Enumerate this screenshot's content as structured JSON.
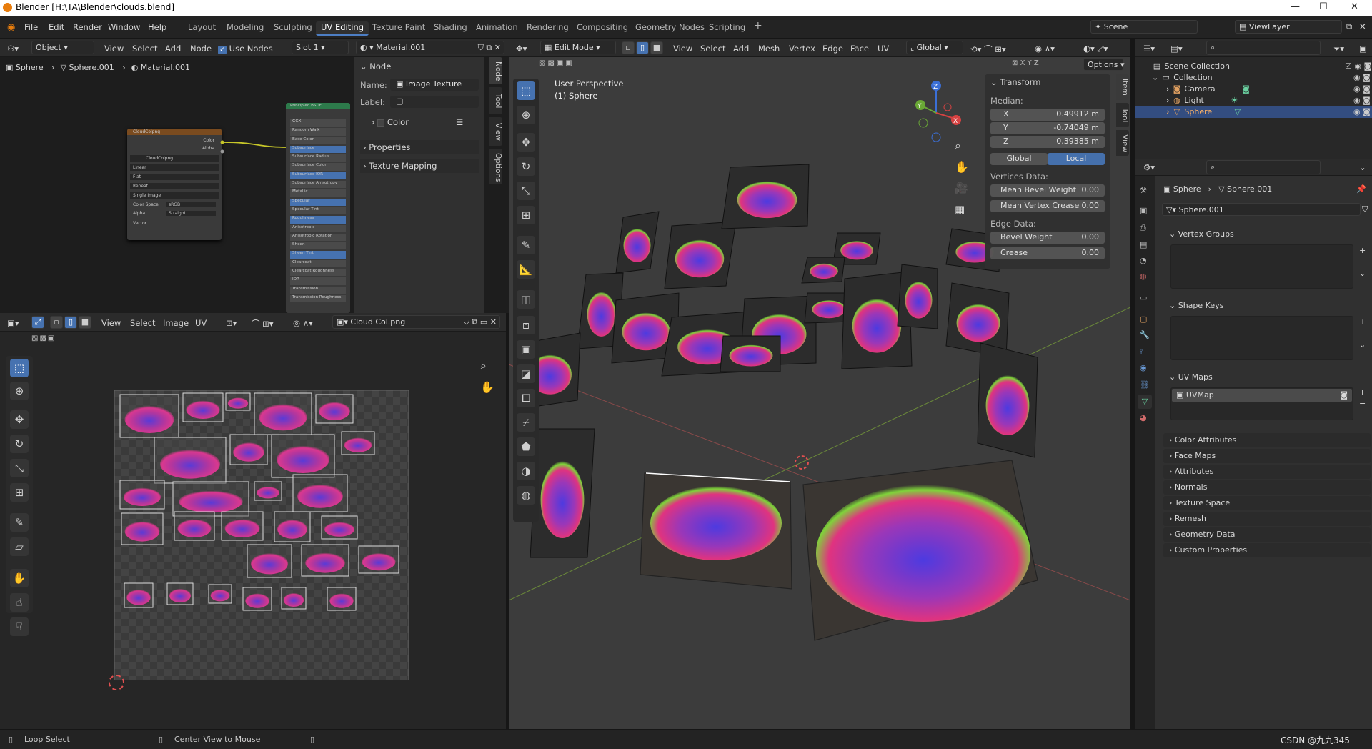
{
  "window": {
    "title": "Blender [H:\\TA\\Blender\\clouds.blend]",
    "min": "—",
    "max": "☐",
    "close": "✕"
  },
  "menu": [
    "File",
    "Edit",
    "Render",
    "Window",
    "Help"
  ],
  "workspaces": [
    "Layout",
    "Modeling",
    "Sculpting",
    "UV Editing",
    "Texture Paint",
    "Shading",
    "Animation",
    "Rendering",
    "Compositing",
    "Geometry Nodes",
    "Scripting"
  ],
  "active_workspace": "UV Editing",
  "add_workspace": "+",
  "scene": {
    "name": "Scene",
    "view_layer": "ViewLayer"
  },
  "node_editor": {
    "mode": "Object",
    "menus": [
      "View",
      "Select",
      "Add",
      "Node"
    ],
    "use_nodes": "Use Nodes",
    "slot": "Slot 1",
    "material": "Material.001",
    "breadcrumb": [
      "Sphere",
      "Sphere.001",
      "Material.001"
    ],
    "image_node": {
      "title": "CloudColpng",
      "outputs": [
        "Color",
        "Alpha"
      ],
      "image": "CloudColpng",
      "interp": "Linear",
      "proj": "Flat",
      "ext": "Repeat",
      "source": "Single Image",
      "colorspace_label": "Color Space",
      "colorspace": "sRGB",
      "alpha_label": "Alpha",
      "alpha": "Straight",
      "vector": "Vector"
    },
    "bsdf_node": {
      "title": "Principled BSDF",
      "rows": [
        "GGX",
        "Random Walk",
        "Base Color",
        "Subsurface",
        "Subsurface Radius",
        "Subsurface Color",
        "Subsurface IOR",
        "Subsurface Anisotropy",
        "Metallic",
        "Specular",
        "Specular Tint",
        "Roughness",
        "Anisotropic",
        "Anisotropic Rotation",
        "Sheen",
        "Sheen Tint",
        "Clearcoat",
        "Clearcoat Roughness",
        "IOR",
        "Transmission",
        "Transmission Roughness"
      ]
    },
    "sidebar": {
      "section": "Node",
      "name_label": "Name:",
      "name_value": "Image Texture",
      "label_label": "Label:",
      "label_value": "",
      "color": "Color",
      "properties": "Properties",
      "texture_mapping": "Texture Mapping"
    },
    "tabs": [
      "Node",
      "Tool",
      "View",
      "Options"
    ]
  },
  "uv_editor": {
    "menus": [
      "View",
      "Select",
      "Image",
      "UV"
    ],
    "image_name": "Cloud Col.png"
  },
  "viewport": {
    "mode": "Edit Mode",
    "menus": [
      "View",
      "Select",
      "Add",
      "Mesh",
      "Vertex",
      "Edge",
      "Face",
      "UV"
    ],
    "orientation": "Global",
    "perspective": "User Perspective",
    "object": "(1) Sphere",
    "options": "Options",
    "axes": [
      "X",
      "Y",
      "Z"
    ],
    "tabs": [
      "Item",
      "Tool",
      "View"
    ],
    "transform": {
      "title": "Transform",
      "median": "Median:",
      "x_label": "X",
      "x": "0.49912 m",
      "y_label": "Y",
      "y": "-0.74049 m",
      "z_label": "Z",
      "z": "0.39385 m",
      "global": "Global",
      "local": "Local",
      "vertices_data": "Vertices Data:",
      "mean_bevel": "Mean Bevel Weight",
      "mean_bevel_val": "0.00",
      "mean_crease": "Mean Vertex Crease",
      "mean_crease_val": "0.00",
      "edge_data": "Edge Data:",
      "bevel": "Bevel Weight",
      "bevel_val": "0.00",
      "crease": "Crease",
      "crease_val": "0.00"
    }
  },
  "outliner": {
    "root": "Scene Collection",
    "collection": "Collection",
    "items": [
      "Camera",
      "Light",
      "Sphere"
    ],
    "selected": "Sphere"
  },
  "properties": {
    "breadcrumb": [
      "Sphere",
      "Sphere.001"
    ],
    "mesh_name": "Sphere.001",
    "vertex_groups": "Vertex Groups",
    "shape_keys": "Shape Keys",
    "uv_maps": "UV Maps",
    "uv_map": "UVMap",
    "sections": [
      "Color Attributes",
      "Face Maps",
      "Attributes",
      "Normals",
      "Texture Space",
      "Remesh",
      "Geometry Data",
      "Custom Properties"
    ]
  },
  "status": {
    "left": "Loop Select",
    "mid": "Center View to Mouse",
    "right": "CSDN @九九345"
  },
  "colors": {
    "accent": "#4672b0",
    "selected_row": "#334d80",
    "header": "#2b2b2b",
    "panel": "#303030",
    "cloud_pink": "#d9388f",
    "cloud_blue": "#5a3ad6"
  }
}
